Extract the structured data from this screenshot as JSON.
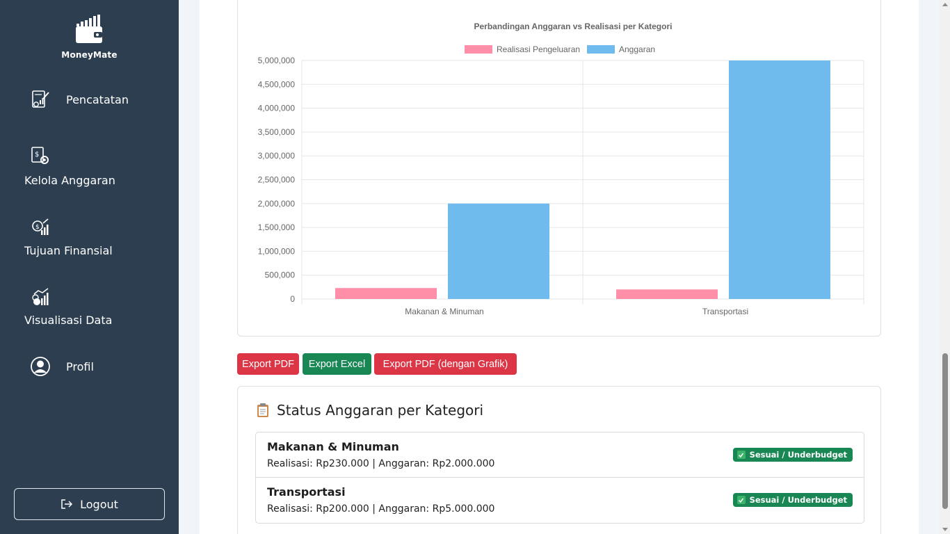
{
  "app": {
    "name": "MoneyMate"
  },
  "sidebar": {
    "items": [
      {
        "label": "Pencatatan",
        "icon": "report-icon"
      },
      {
        "label": "Kelola Anggaran",
        "icon": "budget-gear-icon"
      },
      {
        "label": "Tujuan Finansial",
        "icon": "target-growth-icon"
      },
      {
        "label": "Visualisasi Data",
        "icon": "chart-growth-icon"
      },
      {
        "label": "Profil",
        "icon": "user-icon"
      }
    ],
    "logout_label": "Logout"
  },
  "chart_data": {
    "type": "bar",
    "title": "Perbandingan Anggaran vs Realisasi per Kategori",
    "categories": [
      "Makanan & Minuman",
      "Transportasi"
    ],
    "series": [
      {
        "name": "Realisasi Pengeluaran",
        "values": [
          230000,
          200000
        ],
        "color": "#ff8fa8"
      },
      {
        "name": "Anggaran",
        "values": [
          2000000,
          5000000
        ],
        "color": "#6fbbee"
      }
    ],
    "ylim": [
      0,
      5000000
    ],
    "yticks": [
      "5,000,000",
      "4,500,000",
      "4,000,000",
      "3,500,000",
      "3,000,000",
      "2,500,000",
      "2,000,000",
      "1,500,000",
      "1,000,000",
      "500,000",
      "0"
    ],
    "legend": "top",
    "grid": true
  },
  "actions": {
    "export_pdf": "Export PDF",
    "export_excel": "Export Excel",
    "export_pdf_chart": "Export PDF (dengan Grafik)"
  },
  "status": {
    "title": "Status Anggaran per Kategori",
    "items": [
      {
        "category": "Makanan & Minuman",
        "detail": "Realisasi: Rp230.000 | Anggaran: Rp2.000.000",
        "badge": "Sesuai / Underbudget"
      },
      {
        "category": "Transportasi",
        "detail": "Realisasi: Rp200.000 | Anggaran: Rp5.000.000",
        "badge": "Sesuai / Underbudget"
      }
    ]
  },
  "colors": {
    "sidebar": "#2c3e50",
    "danger": "#dc3545",
    "success": "#198754"
  }
}
